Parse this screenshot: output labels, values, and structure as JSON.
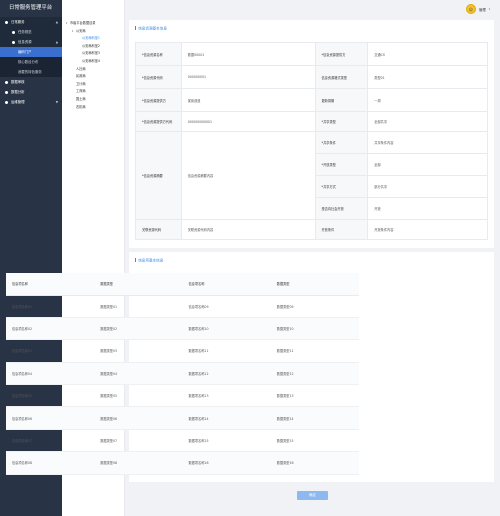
{
  "app": {
    "title": "日常服务管理平台"
  },
  "user": {
    "name": "管理",
    "avatar_text": "☺"
  },
  "sidebar": {
    "items": [
      {
        "label": "日常服务",
        "level": 1,
        "active": true
      },
      {
        "label": "任务规范",
        "level": 2
      },
      {
        "label": "信息资源",
        "level": 2
      },
      {
        "label": "编码门户",
        "level": 3,
        "active": true
      },
      {
        "label": "核心数目分布",
        "level": 3
      },
      {
        "label": "我要的特色服务",
        "level": 3
      },
      {
        "label": "数据审核",
        "level": 1
      },
      {
        "label": "数据分析",
        "level": 1
      },
      {
        "label": "运维管理",
        "level": 1
      }
    ]
  },
  "tree": {
    "nodes": [
      {
        "label": "市级平台数据目录",
        "depth": 0,
        "toggle": "▾"
      },
      {
        "label": "公安局",
        "depth": 1,
        "toggle": "▾"
      },
      {
        "label": "公安局科室1",
        "depth": 2,
        "selected": true
      },
      {
        "label": "公安局科室2",
        "depth": 2
      },
      {
        "label": "公安局科室3",
        "depth": 2
      },
      {
        "label": "公安局科室4",
        "depth": 2
      },
      {
        "label": "人社局",
        "depth": 1
      },
      {
        "label": "民政局",
        "depth": 1
      },
      {
        "label": "卫计局",
        "depth": 1
      },
      {
        "label": "工商局",
        "depth": 1
      },
      {
        "label": "国土局",
        "depth": 1
      },
      {
        "label": "农机局",
        "depth": 1
      }
    ]
  },
  "basic": {
    "title": "信息资源基本信息",
    "rows": [
      {
        "l1": "*信息资源名称",
        "v1": "数据00001",
        "l2": "*信息资源提供方",
        "v2": "交通CS"
      },
      {
        "l1": "*信息资源代码",
        "v1": "000000001",
        "l2": "信息资源格式类型",
        "v2": "类型01"
      },
      {
        "l1": "*信息资源提供方",
        "v1": "某街道道",
        "l2": "更新周期",
        "v2": "一周"
      },
      {
        "l1": "*信息资源提供方代码",
        "v1": "000000000001",
        "l2": "*共享类型",
        "v2": "全部共享"
      },
      {
        "l1": "*信息资源摘要",
        "v1": "信息资源摘要内容",
        "l2": "*共享条件",
        "v2": "共享条件内容"
      },
      {
        "l2": "*开放类型",
        "v2": "全部"
      },
      {
        "l2": "*共享方式",
        "v2": "部分共享"
      },
      {
        "l2": "是否向社会开放",
        "v2": "开放"
      },
      {
        "l1": "关联资源代码",
        "v1": "关联资源代码内容",
        "l2": "开放条件",
        "v2": "开放条件内容"
      }
    ]
  },
  "items_section": {
    "title": "信息项基本信息",
    "headers": [
      "信息项名称",
      "数据类型",
      "信息项名称",
      "数据类型"
    ],
    "rows": [
      [
        "信息项名称01",
        "数据类型01",
        "信息项名称09",
        "数据类型09"
      ],
      [
        "信息项名称02",
        "数据类型02",
        "数据项名称10",
        "数据类型10"
      ],
      [
        "信息项名称03",
        "数据类型03",
        "数据项名称11",
        "数据类型11"
      ],
      [
        "信息项名称04",
        "数据类型04",
        "数据项名称12",
        "数据类型12"
      ],
      [
        "信息项名称05",
        "数据类型05",
        "数据项名称13",
        "数据类型13"
      ],
      [
        "信息项名称06",
        "数据类型06",
        "数据项名称14",
        "数据类型14"
      ],
      [
        "信息项名称07",
        "数据类型07",
        "数据项名称15",
        "数据类型15"
      ],
      [
        "信息项名称08",
        "数据类型08",
        "数据项名称16",
        "数据类型16"
      ]
    ]
  },
  "footer": {
    "ok_label": "确定"
  },
  "colors": {
    "sidebar_bg": "#283446",
    "accent": "#3a8ee6",
    "active_item": "#3a6fd0",
    "button": "#8db8f0"
  }
}
